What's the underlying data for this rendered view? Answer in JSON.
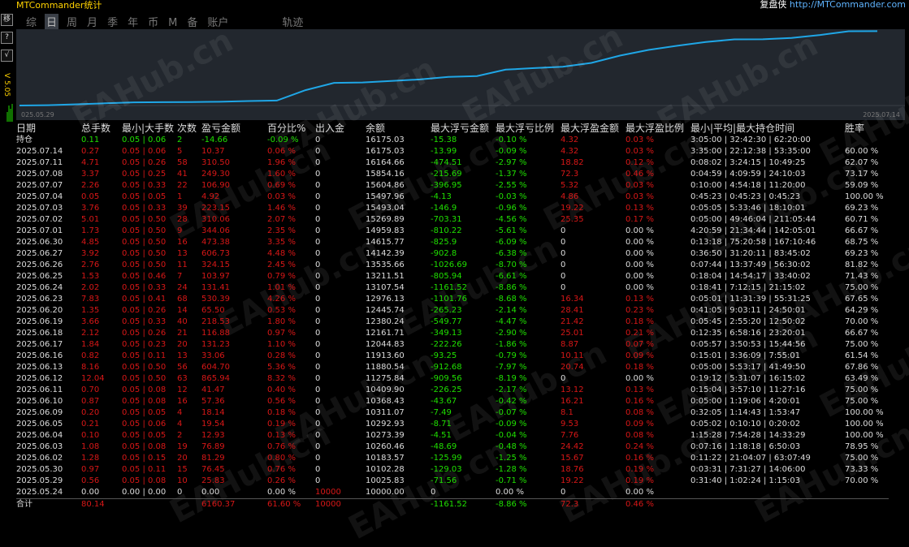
{
  "app": {
    "title": "MTCommander统计",
    "brand_label": "复盘侠",
    "brand_url": "http://MTCommander.com"
  },
  "side_buttons": [
    "移",
    "?",
    "√"
  ],
  "side_text": "V 5.05",
  "tabs": [
    {
      "label": "综",
      "active": false
    },
    {
      "label": "日",
      "active": true
    },
    {
      "label": "周",
      "active": false
    },
    {
      "label": "月",
      "active": false
    },
    {
      "label": "季",
      "active": false
    },
    {
      "label": "年",
      "active": false
    },
    {
      "label": "币",
      "active": false
    },
    {
      "label": "M",
      "active": false
    },
    {
      "label": "备",
      "active": false
    },
    {
      "label": "账户",
      "active": false
    },
    {
      "label": "轨迹",
      "active": false
    }
  ],
  "chart_data": {
    "type": "line",
    "x_start_label": "025.05.29",
    "x_end_label": "2025.07.14",
    "color": "#1fa6e6",
    "values": [
      10000,
      10025.83,
      10102.28,
      10183.57,
      10260.46,
      10273.39,
      10292.93,
      10311.07,
      10368.43,
      10409.9,
      11275.84,
      11880.54,
      11913.6,
      12044.83,
      12161.71,
      12380.24,
      12445.74,
      12976.13,
      13107.54,
      13211.51,
      13535.66,
      14142.39,
      14615.77,
      14959.83,
      15269.89,
      15493.04,
      15497.96,
      15604.86,
      15854.16,
      16164.66,
      16175.03
    ]
  },
  "watermark": "EAHub.cn",
  "headers": [
    "日期",
    "总手数",
    "最小|大手数",
    "次数",
    "盈亏金额",
    "百分比%",
    "出入金",
    "余额",
    "最大浮亏金额",
    "最大浮亏比例",
    "最大浮盈金额",
    "最大浮盈比例",
    "最小|平均|最大持仓时间",
    "胜率"
  ],
  "rows": [
    [
      "持仓",
      "0.11",
      "0.05 | 0.06",
      "2",
      "-14.66",
      "-0.09 %",
      "0",
      "16175.03",
      "-15.38",
      "-0.10 %",
      "4.32",
      "0.03 %",
      "3:05:00 | 32:42:30 | 62:20:00",
      ""
    ],
    [
      "2025.07.14",
      "0.27",
      "0.05 | 0.06",
      "5",
      "10.37",
      "0.06 %",
      "0",
      "16175.03",
      "-13.99",
      "-0.09 %",
      "4.32",
      "0.03 %",
      "3:35:00 | 22:12:38 | 53:35:00",
      "60.00 %"
    ],
    [
      "2025.07.11",
      "4.71",
      "0.05 | 0.26",
      "58",
      "310.50",
      "1.96 %",
      "0",
      "16164.66",
      "-474.51",
      "-2.97 %",
      "18.82",
      "0.12 %",
      "0:08:02 | 3:24:15 | 10:49:25",
      "62.07 %"
    ],
    [
      "2025.07.08",
      "3.37",
      "0.05 | 0.25",
      "41",
      "249.30",
      "1.60 %",
      "0",
      "15854.16",
      "-215.69",
      "-1.37 %",
      "72.3",
      "0.46 %",
      "0:04:59 | 4:09:59 | 24:10:03",
      "73.17 %"
    ],
    [
      "2025.07.07",
      "2.26",
      "0.05 | 0.33",
      "22",
      "106.90",
      "0.69 %",
      "0",
      "15604.86",
      "-396.95",
      "-2.55 %",
      "5.32",
      "0.03 %",
      "0:10:00 | 4:54:18 | 11:20:00",
      "59.09 %"
    ],
    [
      "2025.07.04",
      "0.05",
      "0.05 | 0.05",
      "1",
      "4.92",
      "0.03 %",
      "0",
      "15497.96",
      "-4.13",
      "-0.03 %",
      "4.86",
      "0.03 %",
      "0:45:23 | 0:45:23 | 0:45:23",
      "100.00 %"
    ],
    [
      "2025.07.03",
      "3.76",
      "0.05 | 0.33",
      "39",
      "223.15",
      "1.46 %",
      "0",
      "15493.04",
      "-146.9",
      "-0.96 %",
      "19.22",
      "0.13 %",
      "0:05:05 | 5:33:46 | 18:10:01",
      "69.23 %"
    ],
    [
      "2025.07.02",
      "5.01",
      "0.05 | 0.50",
      "28",
      "310.06",
      "2.07 %",
      "0",
      "15269.89",
      "-703.31",
      "-4.56 %",
      "25.35",
      "0.17 %",
      "0:05:00 | 49:46:04 | 211:05:44",
      "60.71 %"
    ],
    [
      "2025.07.01",
      "1.73",
      "0.05 | 0.50",
      "9",
      "344.06",
      "2.35 %",
      "0",
      "14959.83",
      "-810.22",
      "-5.61 %",
      "0",
      "0.00 %",
      "4:20:59 | 21:34:44 | 142:05:01",
      "66.67 %"
    ],
    [
      "2025.06.30",
      "4.85",
      "0.05 | 0.50",
      "16",
      "473.38",
      "3.35 %",
      "0",
      "14615.77",
      "-825.9",
      "-6.09 %",
      "0",
      "0.00 %",
      "0:13:18 | 75:20:58 | 167:10:46",
      "68.75 %"
    ],
    [
      "2025.06.27",
      "3.92",
      "0.05 | 0.50",
      "13",
      "606.73",
      "4.48 %",
      "0",
      "14142.39",
      "-902.8",
      "-6.38 %",
      "0",
      "0.00 %",
      "0:36:50 | 31:20:11 | 83:45:02",
      "69.23 %"
    ],
    [
      "2025.06.26",
      "2.76",
      "0.05 | 0.50",
      "11",
      "324.15",
      "2.45 %",
      "0",
      "13535.66",
      "-1026.69",
      "-8.70 %",
      "0",
      "0.00 %",
      "0:07:44 | 13:37:49 | 56:30:02",
      "81.82 %"
    ],
    [
      "2025.06.25",
      "1.53",
      "0.05 | 0.46",
      "7",
      "103.97",
      "0.79 %",
      "0",
      "13211.51",
      "-805.94",
      "-6.61 %",
      "0",
      "0.00 %",
      "0:18:04 | 14:54:17 | 33:40:02",
      "71.43 %"
    ],
    [
      "2025.06.24",
      "2.02",
      "0.05 | 0.33",
      "24",
      "131.41",
      "1.01 %",
      "0",
      "13107.54",
      "-1161.52",
      "-8.86 %",
      "0",
      "0.00 %",
      "0:18:41 | 7:12:15 | 21:15:02",
      "75.00 %"
    ],
    [
      "2025.06.23",
      "7.83",
      "0.05 | 0.41",
      "68",
      "530.39",
      "4.26 %",
      "0",
      "12976.13",
      "-1101.76",
      "-8.68 %",
      "16.34",
      "0.13 %",
      "0:05:01 | 11:31:39 | 55:31:25",
      "67.65 %"
    ],
    [
      "2025.06.20",
      "1.35",
      "0.05 | 0.26",
      "14",
      "65.50",
      "0.53 %",
      "0",
      "12445.74",
      "-265.23",
      "-2.14 %",
      "28.41",
      "0.23 %",
      "0:41:05 | 9:03:11 | 24:50:01",
      "64.29 %"
    ],
    [
      "2025.06.19",
      "3.66",
      "0.05 | 0.33",
      "40",
      "218.53",
      "1.80 %",
      "0",
      "12380.24",
      "-549.77",
      "-4.47 %",
      "21.42",
      "0.18 %",
      "0:05:45 | 2:55:20 | 12:50:02",
      "70.00 %"
    ],
    [
      "2025.06.18",
      "2.12",
      "0.05 | 0.26",
      "21",
      "116.88",
      "0.97 %",
      "0",
      "12161.71",
      "-349.13",
      "-2.90 %",
      "25.01",
      "0.21 %",
      "0:12:35 | 6:58:16 | 23:20:01",
      "66.67 %"
    ],
    [
      "2025.06.17",
      "1.84",
      "0.05 | 0.23",
      "20",
      "131.23",
      "1.10 %",
      "0",
      "12044.83",
      "-222.26",
      "-1.86 %",
      "8.87",
      "0.07 %",
      "0:05:57 | 3:50:53 | 15:44:56",
      "75.00 %"
    ],
    [
      "2025.06.16",
      "0.82",
      "0.05 | 0.11",
      "13",
      "33.06",
      "0.28 %",
      "0",
      "11913.60",
      "-93.25",
      "-0.79 %",
      "10.11",
      "0.09 %",
      "0:15:01 | 3:36:09 | 7:55:01",
      "61.54 %"
    ],
    [
      "2025.06.13",
      "8.16",
      "0.05 | 0.50",
      "56",
      "604.70",
      "5.36 %",
      "0",
      "11880.54",
      "-912.68",
      "-7.97 %",
      "20.74",
      "0.18 %",
      "0:05:00 | 5:53:17 | 41:49:50",
      "67.86 %"
    ],
    [
      "2025.06.12",
      "12.04",
      "0.05 | 0.50",
      "63",
      "865.94",
      "8.32 %",
      "0",
      "11275.84",
      "-909.56",
      "-8.19 %",
      "0",
      "0.00 %",
      "0:19:12 | 5:31:07 | 16:15:02",
      "63.49 %"
    ],
    [
      "2025.06.11",
      "0.70",
      "0.05 | 0.08",
      "12",
      "41.47",
      "0.40 %",
      "0",
      "10409.90",
      "-226.25",
      "-2.17 %",
      "13.12",
      "0.13 %",
      "0:15:04 | 3:57:10 | 11:27:16",
      "75.00 %"
    ],
    [
      "2025.06.10",
      "0.87",
      "0.05 | 0.08",
      "16",
      "57.36",
      "0.56 %",
      "0",
      "10368.43",
      "-43.67",
      "-0.42 %",
      "16.21",
      "0.16 %",
      "0:05:00 | 1:19:06 | 4:20:01",
      "75.00 %"
    ],
    [
      "2025.06.09",
      "0.20",
      "0.05 | 0.05",
      "4",
      "18.14",
      "0.18 %",
      "0",
      "10311.07",
      "-7.49",
      "-0.07 %",
      "8.1",
      "0.08 %",
      "0:32:05 | 1:14:43 | 1:53:47",
      "100.00 %"
    ],
    [
      "2025.06.05",
      "0.21",
      "0.05 | 0.06",
      "4",
      "19.54",
      "0.19 %",
      "0",
      "10292.93",
      "-8.71",
      "-0.09 %",
      "9.53",
      "0.09 %",
      "0:05:02 | 0:10:10 | 0:20:02",
      "100.00 %"
    ],
    [
      "2025.06.04",
      "0.10",
      "0.05 | 0.05",
      "2",
      "12.93",
      "0.13 %",
      "0",
      "10273.39",
      "-4.51",
      "-0.04 %",
      "7.76",
      "0.08 %",
      "1:15:28 | 7:54:28 | 14:33:29",
      "100.00 %"
    ],
    [
      "2025.06.03",
      "1.08",
      "0.05 | 0.08",
      "19",
      "76.89",
      "0.76 %",
      "0",
      "10260.46",
      "-48.69",
      "-0.48 %",
      "24.42",
      "0.24 %",
      "0:07:16 | 1:18:18 | 6:50:03",
      "78.95 %"
    ],
    [
      "2025.06.02",
      "1.28",
      "0.05 | 0.15",
      "20",
      "81.29",
      "0.80 %",
      "0",
      "10183.57",
      "-125.99",
      "-1.25 %",
      "15.67",
      "0.16 %",
      "0:11:22 | 21:04:07 | 63:07:49",
      "75.00 %"
    ],
    [
      "2025.05.30",
      "0.97",
      "0.05 | 0.11",
      "15",
      "76.45",
      "0.76 %",
      "0",
      "10102.28",
      "-129.03",
      "-1.28 %",
      "18.76",
      "0.19 %",
      "0:03:31 | 7:31:27 | 14:06:00",
      "73.33 %"
    ],
    [
      "2025.05.29",
      "0.56",
      "0.05 | 0.08",
      "10",
      "25.83",
      "0.26 %",
      "0",
      "10025.83",
      "-71.56",
      "-0.71 %",
      "19.22",
      "0.19 %",
      "0:31:40 | 1:02:24 | 1:15:03",
      "70.00 %"
    ],
    [
      "2025.05.24",
      "0.00",
      "0.00 | 0.00",
      "0",
      "0.00",
      "0.00 %",
      "10000",
      "10000.00",
      "0",
      "0.00 %",
      "0",
      "0.00 %",
      "",
      ""
    ]
  ],
  "total": [
    "合计",
    "80.14",
    "",
    "",
    "6160.37",
    "61.60 %",
    "10000",
    "",
    "-1161.52",
    "-8.86 %",
    "72.3",
    "0.46 %",
    "",
    ""
  ]
}
